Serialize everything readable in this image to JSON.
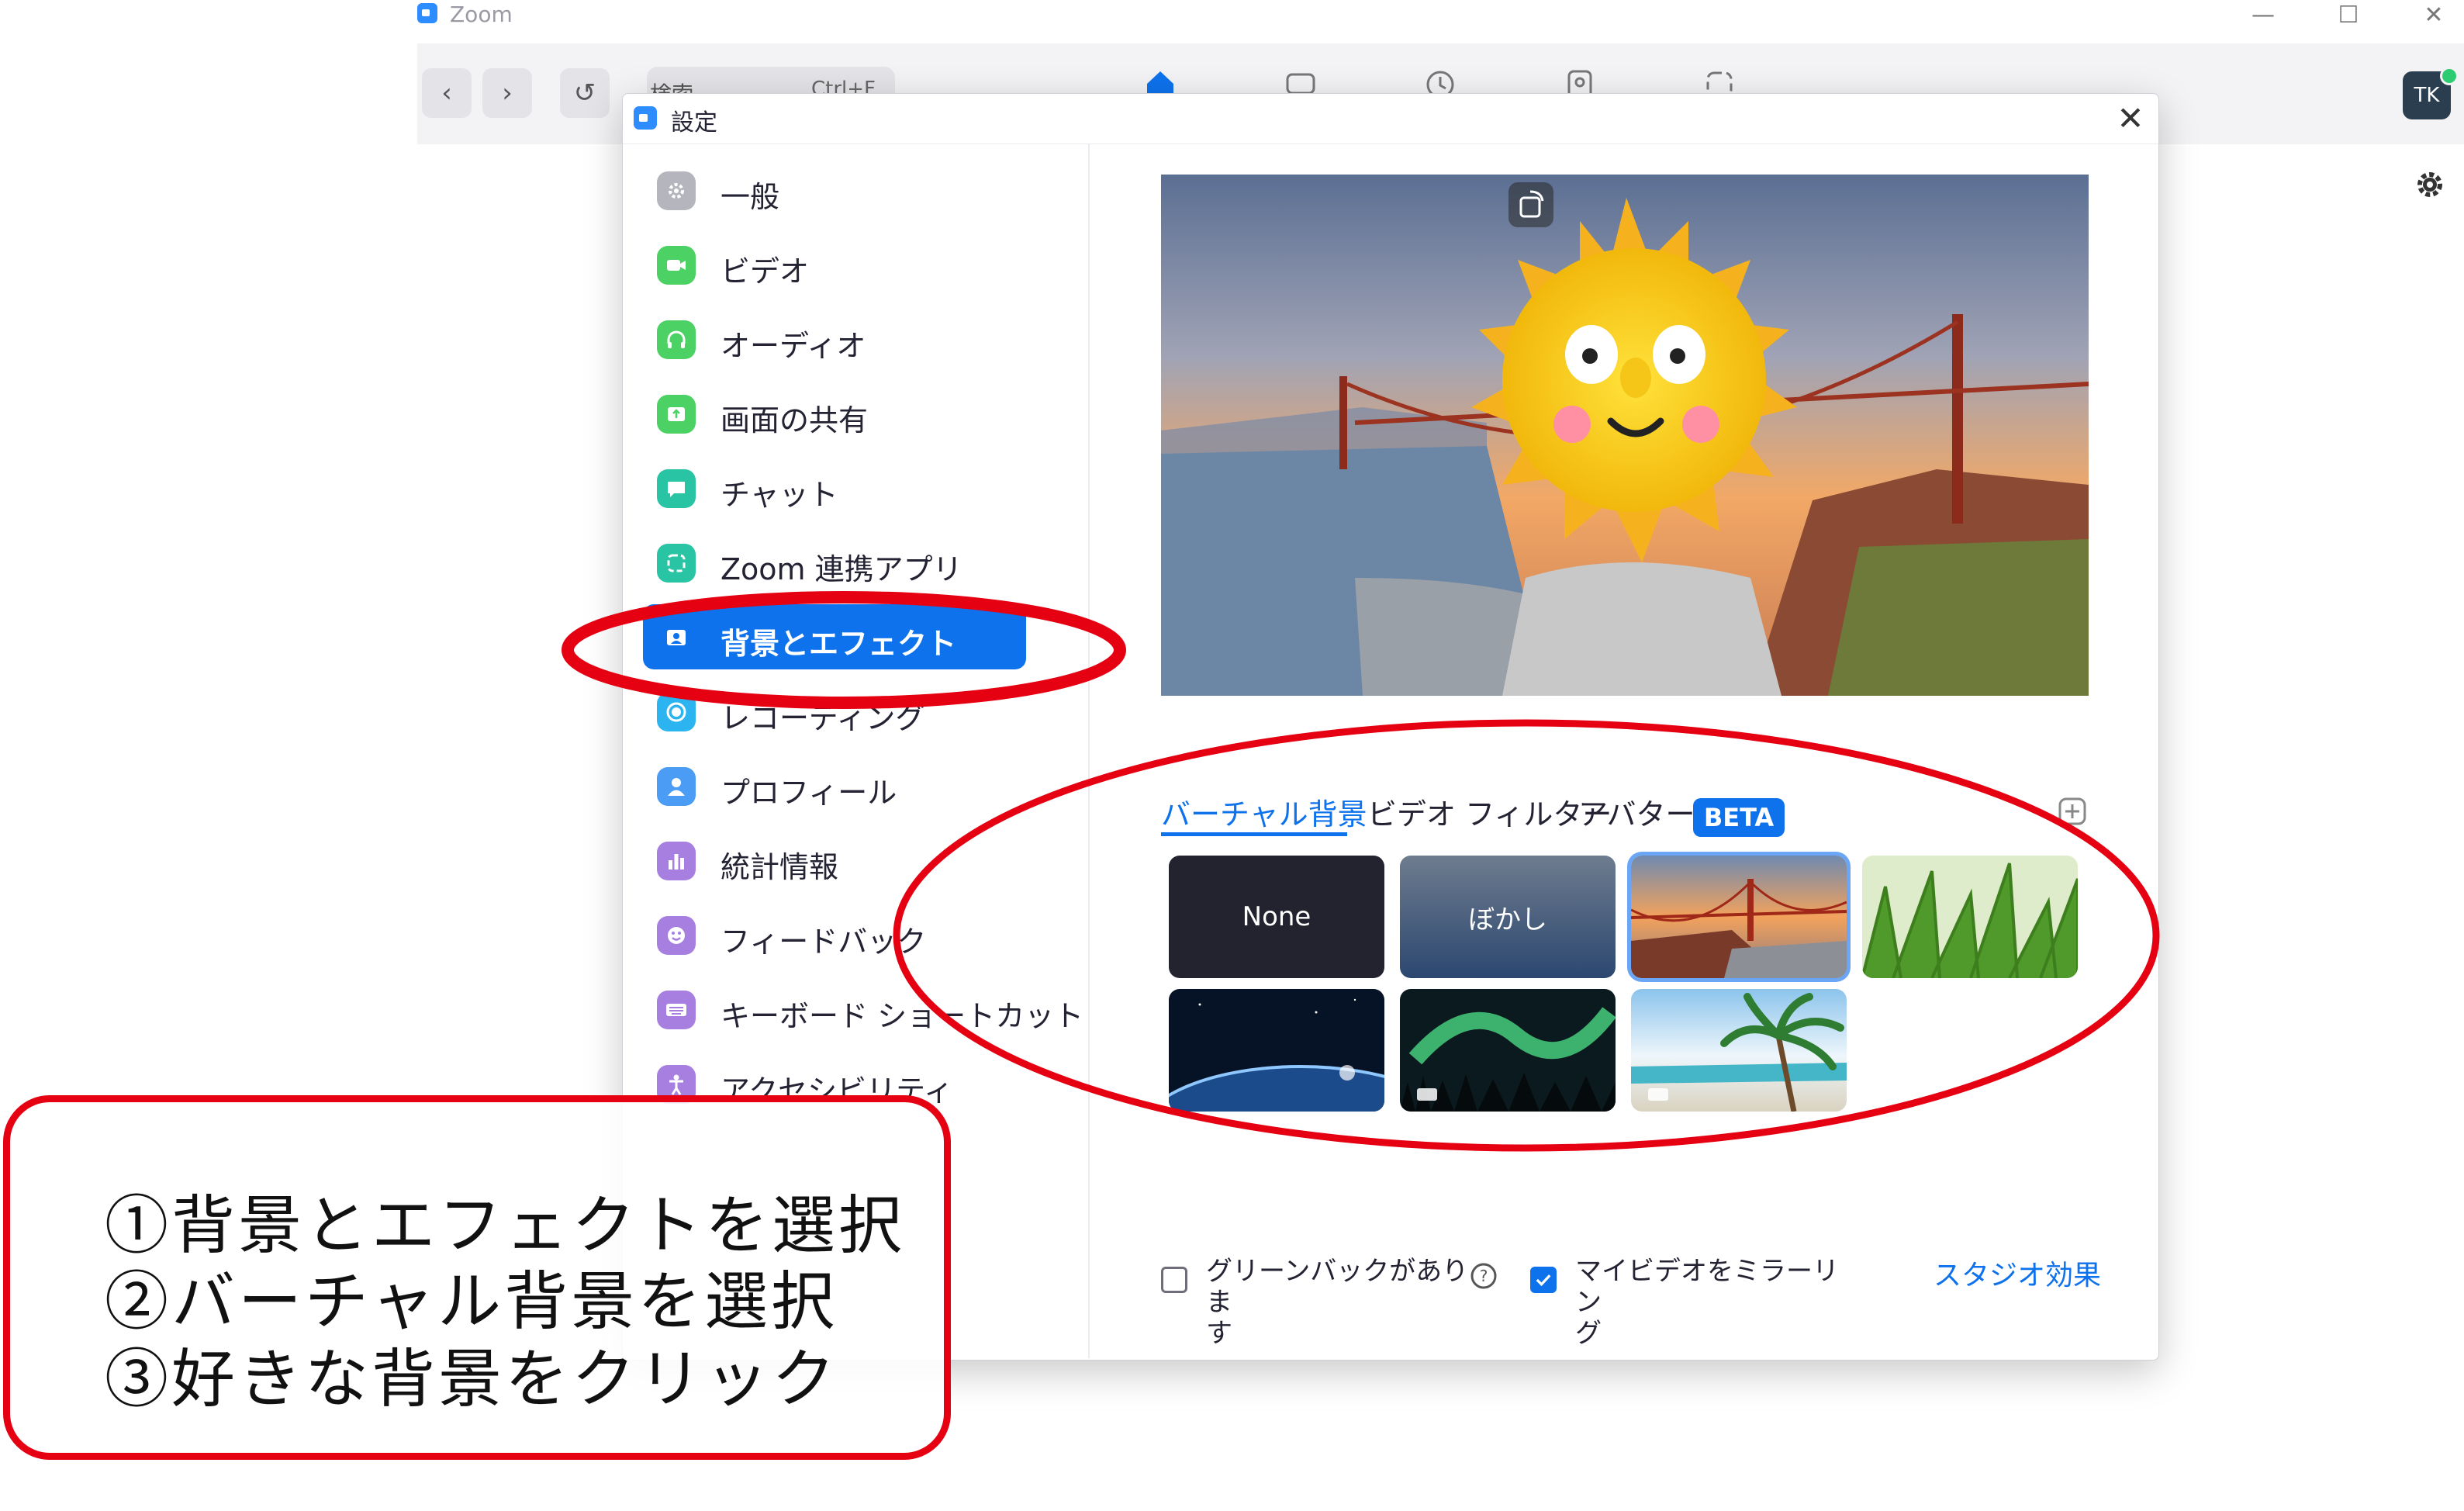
{
  "app": {
    "title": "Zoom",
    "window_controls": {
      "minimize": "—",
      "maximize": "☐",
      "close": "✕"
    }
  },
  "toolbar": {
    "back_icon": "chevron-left-icon",
    "forward_icon": "chevron-right-icon",
    "history_icon": "history-icon",
    "search_placeholder": "検索",
    "search_shortcut": "Ctrl+F",
    "tabs": [
      "home-icon",
      "chat-icon",
      "meetings-clock-icon",
      "contacts-icon",
      "apps-icon"
    ],
    "avatar_initials": "TK"
  },
  "dialog": {
    "title": "設定",
    "close": "✕"
  },
  "sidebar": {
    "items": [
      {
        "label": "一般",
        "icon": "gear-icon",
        "color": "#b5b5bd"
      },
      {
        "label": "ビデオ",
        "icon": "video-camera-icon",
        "color": "#4CD264"
      },
      {
        "label": "オーディオ",
        "icon": "headphones-icon",
        "color": "#4CD264"
      },
      {
        "label": "画面の共有",
        "icon": "share-screen-icon",
        "color": "#4CD264"
      },
      {
        "label": "チャット",
        "icon": "chat-bubble-icon",
        "color": "#29C4A3"
      },
      {
        "label": "Zoom 連携アプリ",
        "icon": "apps-icon",
        "color": "#29C4A3"
      },
      {
        "label": "背景とエフェクト",
        "icon": "background-person-icon",
        "color": "#0E72ED"
      },
      {
        "label": "レコーディング",
        "icon": "record-icon",
        "color": "#2BB4F0"
      },
      {
        "label": "プロフィール",
        "icon": "profile-icon",
        "color": "#4A9CF5"
      },
      {
        "label": "統計情報",
        "icon": "statistics-icon",
        "color": "#A77FE0"
      },
      {
        "label": "フィードバック",
        "icon": "smile-icon",
        "color": "#A77FE0"
      },
      {
        "label": "キーボード ショートカット",
        "icon": "keyboard-icon",
        "color": "#A77FE0"
      },
      {
        "label": "アクセシビリティ",
        "icon": "accessibility-icon",
        "color": "#A77FE0"
      }
    ]
  },
  "background_panel": {
    "tabs": [
      "バーチャル背景",
      "ビデオ フィルター",
      "アバター"
    ],
    "beta_badge": "BETA",
    "thumbnails": [
      {
        "label": "None",
        "kind": "none"
      },
      {
        "label": "ぼかし",
        "kind": "blur"
      },
      {
        "label": "",
        "kind": "golden-gate",
        "selected": true
      },
      {
        "label": "",
        "kind": "grass"
      },
      {
        "label": "",
        "kind": "earth-space"
      },
      {
        "label": "",
        "kind": "aurora",
        "video": true
      },
      {
        "label": "",
        "kind": "beach-palm",
        "video": true
      }
    ],
    "options": {
      "green_screen": {
        "label": "グリーンバックがありま\nす",
        "checked": false
      },
      "mirror_video": {
        "label": "マイビデオをミラーリン\nグ",
        "checked": true
      }
    },
    "studio_effects": "スタジオ効果"
  },
  "annotation": {
    "lines": [
      "①背景とエフェクトを選択",
      "②バーチャル背景を選択",
      "③好きな背景をクリック"
    ],
    "color": "#E50012"
  }
}
